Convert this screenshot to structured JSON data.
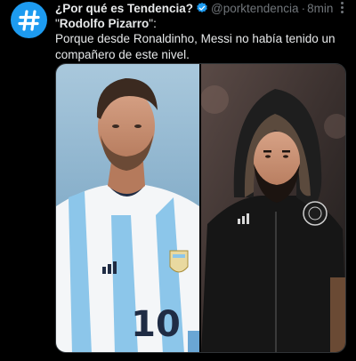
{
  "tweet": {
    "display_name": "¿Por qué es Tendencia?",
    "handle": "@porktendencia",
    "separator": "·",
    "time": "8min",
    "quote_open": "\"",
    "quoted_name": "Rodolfo Pizarro",
    "quote_close": "\":",
    "text": "Porque desde Ronaldinho, Messi no había tenido un compañero de este nivel.",
    "left_photo_shirt_number": "10"
  },
  "colors": {
    "background": "#000000",
    "text_primary": "#e7e9ea",
    "text_secondary": "#71767b",
    "accent": "#1d9bf0"
  },
  "icons": {
    "avatar": "hashtag-icon",
    "verified": "verified-badge-icon",
    "more": "more-options-icon"
  }
}
